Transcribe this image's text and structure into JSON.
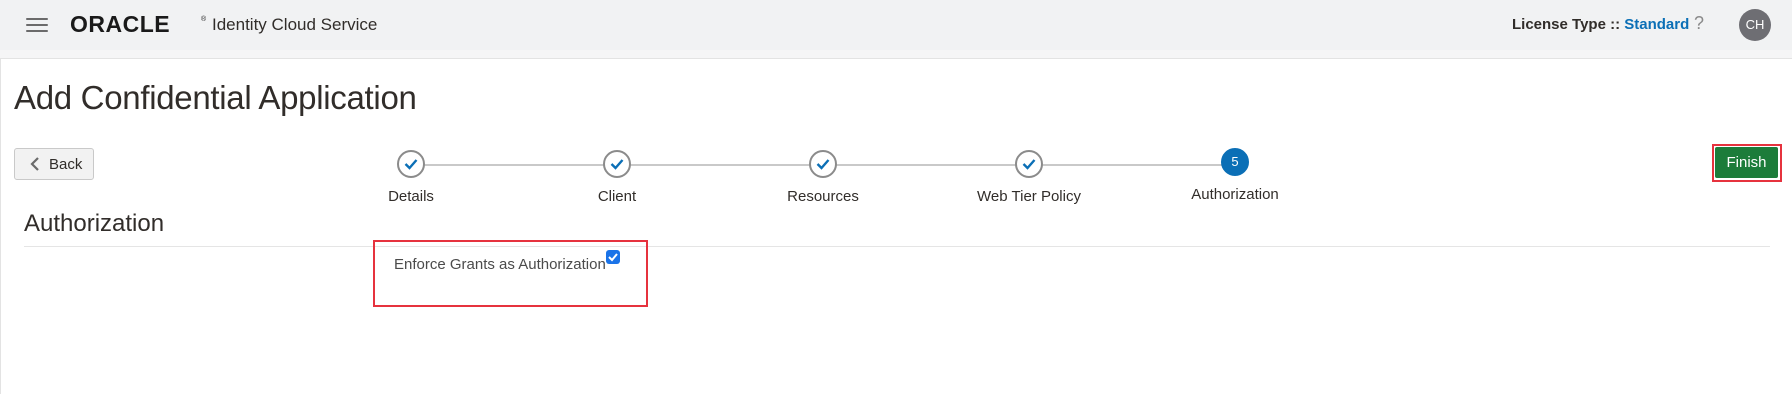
{
  "header": {
    "logo_text": "ORACLE",
    "service_name": "Identity Cloud Service",
    "license_label": "License Type ::",
    "license_value": "Standard",
    "help_text": "?",
    "avatar_initials": "CH"
  },
  "page": {
    "title": "Add Confidential Application",
    "back_label": "Back",
    "finish_label": "Finish"
  },
  "steps": [
    {
      "label": "Details",
      "state": "complete"
    },
    {
      "label": "Client",
      "state": "complete"
    },
    {
      "label": "Resources",
      "state": "complete"
    },
    {
      "label": "Web Tier Policy",
      "state": "complete"
    },
    {
      "label": "Authorization",
      "state": "current",
      "number": "5"
    }
  ],
  "section": {
    "title": "Authorization",
    "grant_label": "Enforce Grants as Authorization",
    "grant_checked": true
  },
  "colors": {
    "accent": "#0b6fb6",
    "finish": "#1c7c3a",
    "highlight": "#e6323e"
  }
}
